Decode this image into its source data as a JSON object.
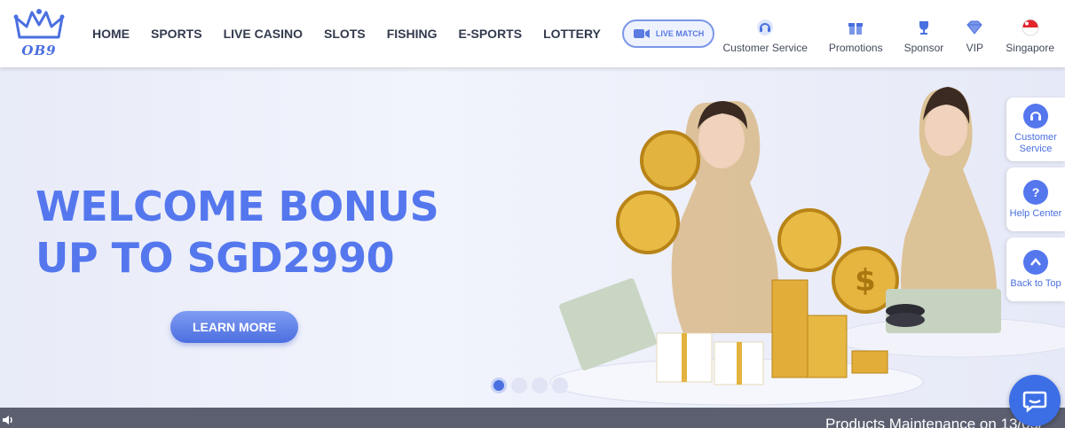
{
  "brand": {
    "logo_text": "OB9"
  },
  "nav": {
    "items": [
      "HOME",
      "SPORTS",
      "LIVE CASINO",
      "SLOTS",
      "FISHING",
      "E-SPORTS",
      "LOTTERY"
    ],
    "live_match": "LIVE MATCH"
  },
  "header_links": [
    {
      "label": "Customer Service",
      "icon": "headset-icon"
    },
    {
      "label": "Promotions",
      "icon": "gift-icon"
    },
    {
      "label": "Sponsor",
      "icon": "trophy-icon"
    },
    {
      "label": "VIP",
      "icon": "diamond-icon"
    },
    {
      "label": "Singapore",
      "icon": "singapore-flag-icon"
    }
  ],
  "banner": {
    "headline_line1": "WELCOME BONUS",
    "headline_line2": "UP TO SGD2990",
    "cta": "LEARN MORE",
    "slide_count": 4,
    "active_slide": 1
  },
  "side_widget": {
    "customer_service": "Customer Service",
    "help_center": "Help Center",
    "back_to_top": "Back to Top"
  },
  "marquee": {
    "text": "Products Maintenance on 13/05/"
  },
  "colors": {
    "accent": "#5577ee",
    "marquee_bg": "#5b5f70",
    "chat": "#3c6ee6"
  }
}
